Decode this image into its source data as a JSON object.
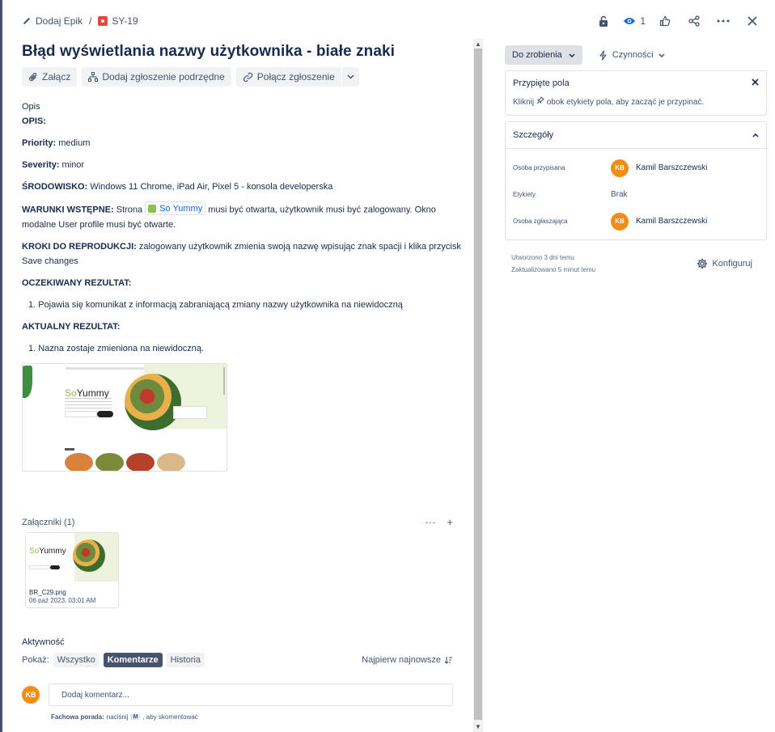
{
  "topbar": {
    "epic_label": "Dodaj Epik",
    "separator": "/",
    "issue_key": "SY-19",
    "watch_count": "1"
  },
  "issue": {
    "title": "Błąd wyświetlania nazwy użytkownika - białe znaki",
    "buttons": {
      "attach": "Załącz",
      "add_child": "Dodaj zgłoszenie podrzędne",
      "link": "Połącz zgłoszenie"
    }
  },
  "description": {
    "heading": "Opis",
    "opis": "OPIS:",
    "priority_label": "Priority:",
    "priority_value": "medium",
    "severity_label": "Severity:",
    "severity_value": "minor",
    "env_label": "ŚRODOWISKO:",
    "env_value": "Windows 11 Chrome,  iPad Air, Pixel 5 - konsola developerska",
    "pre_label": "WARUNKI WSTĘPNE:",
    "pre_before": "Strona",
    "pre_link": "So Yummy",
    "pre_after": "musi być otwarta, użytkownik musi być zalogowany. Okno modalne User profile musi być otwarte.",
    "steps_label": "KROKI DO REPRODUKCJI:",
    "steps_value": "zalogowany użytkownik zmienia swoją nazwę wpisując znak spacji i klika przycisk Save changes",
    "expected_label": "OCZEKIWANY REZULTAT:",
    "expected_item": "1. Pojawia się komunikat z informacją zabraniającą zmiany nazwy użytkownika na niewidoczną",
    "actual_label": "AKTUALNY REZULTAT:",
    "actual_item": "1. Nazna zostaje zmieniona na niewidoczną.",
    "preview_logo_a": "So",
    "preview_logo_b": "Yummy"
  },
  "attachments": {
    "title": "Załączniki (1)",
    "more": "···",
    "add": "+",
    "file_name": "BR_C29.png",
    "file_date": "06 paź 2023, 03:01 AM",
    "logo_a": "So",
    "logo_b": "Yummy"
  },
  "activity": {
    "title": "Aktywność",
    "show_label": "Pokaż:",
    "filters": [
      "Wszystko",
      "Komentarze",
      "Historia"
    ],
    "active_filter": "Komentarze",
    "sort_label": "Najpierw najnowsze",
    "avatar_initials": "KB",
    "comment_placeholder": "Dodaj komentarz...",
    "tip_bold": "Fachowa porada:",
    "tip_pre": "naciśnij",
    "tip_key": "M",
    "tip_post": ", aby skomentować"
  },
  "sidebar": {
    "status": "Do zrobienia",
    "actions": "Czynności",
    "pinned_title": "Przypięte pola",
    "pinned_text_pre": "Kliknij",
    "pinned_text_post": "obok etykiety pola, aby zacząć je przypinać.",
    "details_title": "Szczegóły",
    "fields": [
      {
        "label": "Osoba przypisana",
        "value": "Kamil Barszczewski",
        "initials": "KB"
      },
      {
        "label": "Etykiety",
        "value": "Brak"
      },
      {
        "label": "Osoba zgłaszająca",
        "value": "Kamil Barszczewski",
        "initials": "KB"
      }
    ],
    "created": "Utworzono 3 dni temu",
    "updated": "Zaktualizowano 5 minut temu",
    "configure": "Konfiguruj"
  },
  "colors": {
    "accent": "#0c66e4",
    "avatar": "#f18d13",
    "bug": "#e5493a",
    "active_chip": "#44546f"
  },
  "icons": [
    "pencil-icon",
    "bug-icon",
    "lock-icon",
    "eye-icon",
    "thumbs-up-icon",
    "share-icon",
    "more-icon",
    "close-icon",
    "paperclip-icon",
    "child-issue-icon",
    "link-icon",
    "chevron-down-icon",
    "lightning-icon",
    "pin-icon",
    "chevron-up-icon",
    "gear-icon",
    "sort-icon"
  ]
}
